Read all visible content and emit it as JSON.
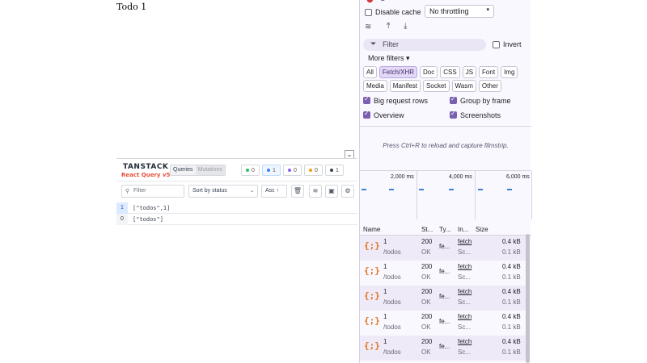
{
  "app": {
    "title": "Todo 1"
  },
  "tanstack": {
    "logo_line1": "TANSTACK",
    "logo_line2": "React Query v5",
    "tabs": [
      {
        "label": "Queries",
        "active": true
      },
      {
        "label": "Mutations",
        "active": false
      }
    ],
    "status_badges": [
      {
        "count": "0",
        "color": "#22c55e"
      },
      {
        "count": "1",
        "color": "#3b82f6"
      },
      {
        "count": "0",
        "color": "#6b7280"
      },
      {
        "count": "0",
        "color": "#f59e0b"
      },
      {
        "count": "1",
        "color": "#374151"
      }
    ],
    "filter_placeholder": "Filter",
    "sort_label": "Sort by status",
    "asc_label": "Asc ↑",
    "queries": [
      {
        "count": "1",
        "key": "[\"todos\",1]",
        "count_bg": "#dbeafe",
        "count_color": "#1d4ed8"
      },
      {
        "count": "0",
        "key": "[\"todos\"]",
        "count_bg": "#f3f4f6",
        "count_color": "#374151"
      }
    ]
  },
  "devtools": {
    "disable_cache_label": "Disable cache",
    "throttling_value": "No throttling",
    "filter_placeholder": "Filter",
    "invert_label": "Invert",
    "more_filters_label": "More filters",
    "type_chips_row1": [
      "All",
      "Fetch/XHR",
      "Doc",
      "CSS",
      "JS",
      "Font",
      "Img"
    ],
    "type_chips_row2": [
      "Media",
      "Manifest",
      "Socket",
      "Wasm",
      "Other"
    ],
    "active_chip": "Fetch/XHR",
    "options": {
      "big_request_rows": "Big request rows",
      "group_by_frame": "Group by frame",
      "overview": "Overview",
      "screenshots": "Screenshots"
    },
    "hint": "Press Ctrl+R to reload and capture filmstrip.",
    "timeline_ticks": [
      "2,000 ms",
      "4,000 ms",
      "6,000 ms"
    ],
    "columns": [
      "Name",
      "St...",
      "Ty...",
      "In...",
      "Size"
    ],
    "requests": [
      {
        "name": "1",
        "path": "/todos",
        "status": "200",
        "status_text": "OK",
        "type": "fe...",
        "initiator": "fetch",
        "initiator_sub": "Sc...",
        "size": "0.4 kB",
        "resource": "0.1 kB"
      },
      {
        "name": "1",
        "path": "/todos",
        "status": "200",
        "status_text": "OK",
        "type": "fe...",
        "initiator": "fetch",
        "initiator_sub": "Sc...",
        "size": "0.4 kB",
        "resource": "0.1 kB"
      },
      {
        "name": "1",
        "path": "/todos",
        "status": "200",
        "status_text": "OK",
        "type": "fe...",
        "initiator": "fetch",
        "initiator_sub": "Sc...",
        "size": "0.4 kB",
        "resource": "0.1 kB"
      },
      {
        "name": "1",
        "path": "/todos",
        "status": "200",
        "status_text": "OK",
        "type": "fe...",
        "initiator": "fetch",
        "initiator_sub": "Sc...",
        "size": "0.4 kB",
        "resource": "0.1 kB"
      },
      {
        "name": "1",
        "path": "/todos",
        "status": "200",
        "status_text": "OK",
        "type": "fe...",
        "initiator": "fetch",
        "initiator_sub": "Sc...",
        "size": "0.4 kB",
        "resource": "0.1 kB"
      }
    ]
  }
}
